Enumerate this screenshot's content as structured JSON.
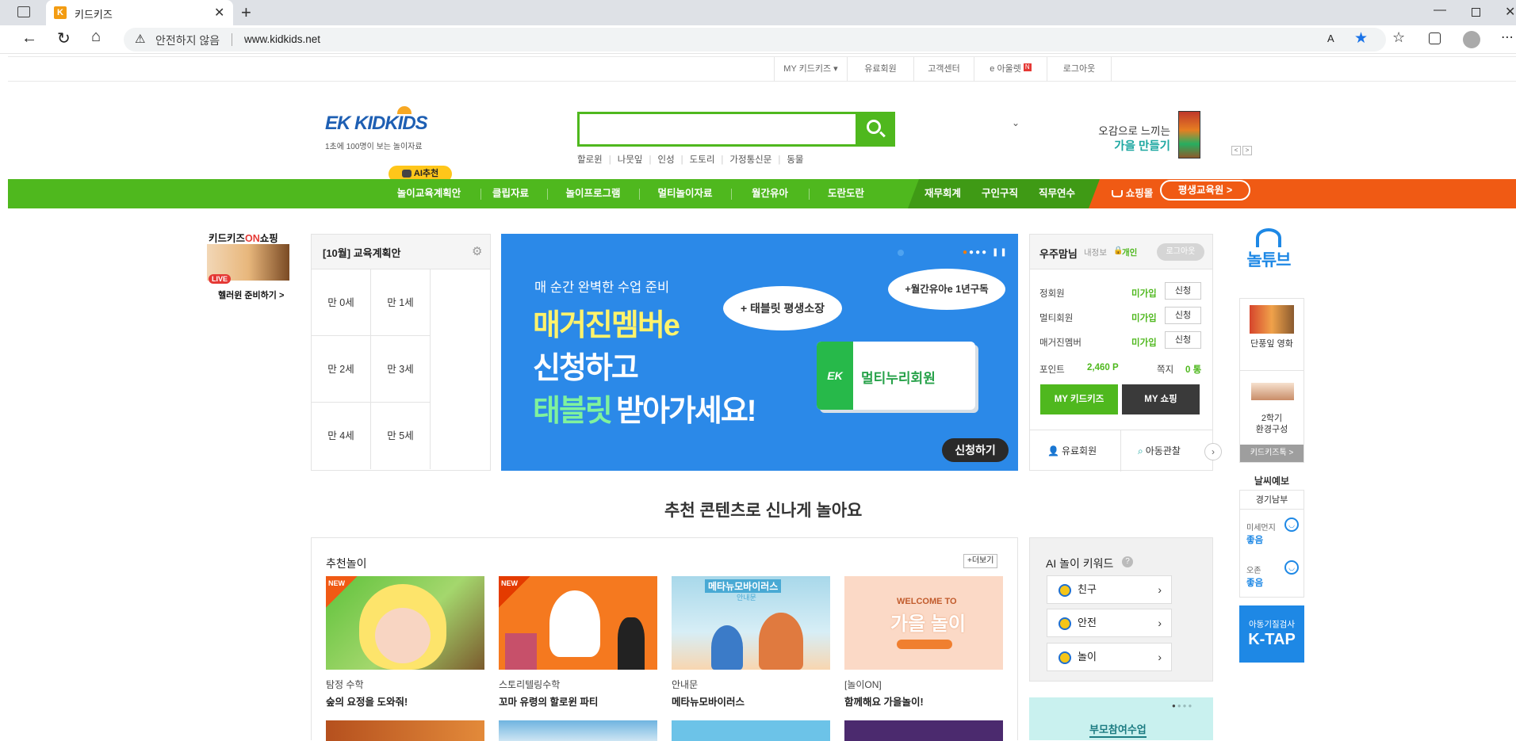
{
  "browser": {
    "tab_title": "키드키즈",
    "security_label": "안전하지 않음",
    "url": "www.kidkids.net"
  },
  "util_nav": [
    "MY 키드키즈 ▾",
    "유료회원",
    "고객센터",
    "e 아울렛",
    "로그아웃"
  ],
  "util_badge": "N",
  "logo": {
    "brand": "EK KIDKIDS",
    "tagline": "1초에 100명이 보는 놀이자료"
  },
  "search": {
    "placeholder": "",
    "keywords": [
      "할로윈",
      "나뭇잎",
      "인성",
      "도토리",
      "가정통신문",
      "동물"
    ]
  },
  "promo": {
    "line1": "오감으로 느끼는",
    "line2": "가을 만들기",
    "prev": "<",
    "next": ">"
  },
  "ai_badge": "AI추천",
  "gnb": {
    "items": [
      "놀이교육계획안",
      "클립자료",
      "놀이프로그램",
      "멀티놀이자료",
      "월간유아",
      "도란도란"
    ],
    "dark_items": [
      "재무회계",
      "구인구직",
      "직무연수"
    ],
    "shop": "쇼핑몰",
    "edu": "평생교육원 >"
  },
  "left_banner": {
    "title": "키드키즈ON쇼핑",
    "live": "LIVE",
    "sub": "헬러윈 준비하기 >"
  },
  "plan": {
    "title": "[10월] 교육계획안",
    "ages": [
      "만 0세",
      "만 1세",
      "만 2세",
      "만 3세",
      "만 4세",
      "만 5세"
    ]
  },
  "hero": {
    "kicker": "매 순간 완벽한 수업 준비",
    "line1": "매거진멤버e",
    "line2": "신청하고",
    "line3a": "태블릿",
    "line3b": "받아가세요!",
    "bubble1": "+ 태블릿 평생소장",
    "bubble2": "+월간유아e 1년구독",
    "card": "멀티누리회원",
    "card_logo": "EK",
    "cta": "신청하기"
  },
  "member": {
    "name": "우주맘님",
    "info": "내정보",
    "type": "개인",
    "logout": "로그아웃",
    "rows": [
      {
        "label": "정회원",
        "status": "미가입",
        "btn": "신청"
      },
      {
        "label": "멀티회원",
        "status": "미가입",
        "btn": "신청"
      },
      {
        "label": "매거진멤버",
        "status": "미가입",
        "btn": "신청"
      }
    ],
    "point_label": "포인트",
    "point_value": "2,460 P",
    "note_label": "쪽지",
    "note_value": "0 통",
    "my_btn": "MY 키드키즈",
    "shop_btn": "MY 쇼핑",
    "paid": "유료회원",
    "observe": "아동관찰"
  },
  "section_title": "추천 콘텐츠로 신나게 놀아요",
  "recommend": {
    "title": "추천놀이",
    "more": "+더보기",
    "new_label": "NEW",
    "cards": [
      {
        "cat": "탐정 수학",
        "title": "숲의 요정을 도와줘!"
      },
      {
        "cat": "스토리텔링수학",
        "title": "꼬마 유령의 할로윈 파티"
      },
      {
        "cat": "안내문",
        "title": "메타뉴모바이러스",
        "img_text": "메타뉴모바이러스",
        "img_sub": "안내문"
      },
      {
        "cat": "[놀이ON]",
        "title": "함께해요 가을놀이!",
        "img_text": "WELCOME TO",
        "img_sub": "가을 놀이"
      }
    ]
  },
  "ai_keyword": {
    "title": "AI 놀이 키워드",
    "help": "?",
    "items": [
      "친구",
      "안전",
      "놀이"
    ]
  },
  "parent_banner": "부모참여수업",
  "right_rail": {
    "logo": "놀튜브",
    "item1": "단풍잎 영화",
    "item2a": "2학기",
    "item2b": "환경구성",
    "more": "키드키즈톡 >",
    "weather_title": "날씨예보",
    "region": "경기남부",
    "dust_label": "미세먼지",
    "dust_value": "좋음",
    "ozone_label": "오존",
    "ozone_value": "좋음",
    "ktap_top": "아동기질검사",
    "ktap": "K-TAP"
  },
  "colors": {
    "green": "#4fb81e",
    "orange": "#f05a14",
    "blue": "#2b89e8",
    "dark": "#3a3a3a"
  }
}
